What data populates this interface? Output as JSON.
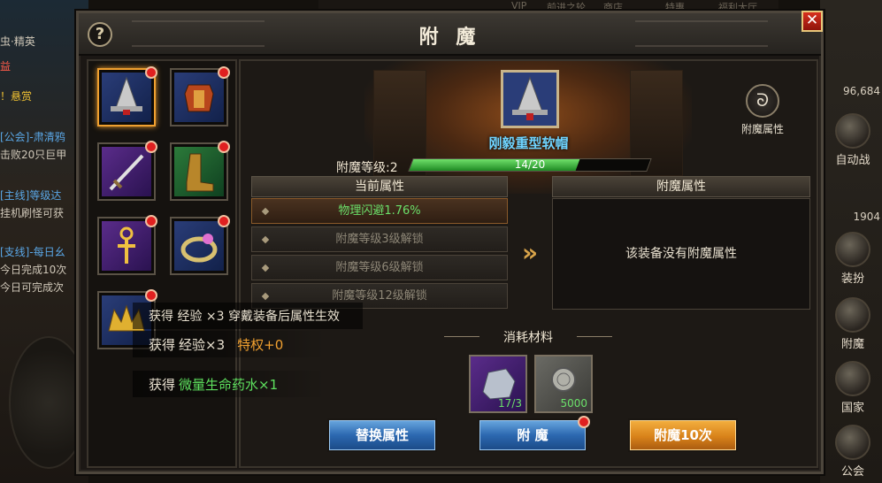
{
  "hud": {
    "top_items": [
      "VIP",
      "前进之轮",
      "商店",
      "特惠",
      "福利大厅"
    ],
    "quest_lines": [
      {
        "text": "虫·精英",
        "style": ""
      },
      {
        "text": "益",
        "style": "red"
      },
      {
        "text": "！悬赏",
        "style": "gold"
      },
      {
        "text": "[公会]-肃清鸦",
        "style": "blue"
      },
      {
        "text": "击败20只巨甲",
        "style": ""
      },
      {
        "text": "[主线]等级达",
        "style": "blue"
      },
      {
        "text": "挂机刷怪可获",
        "style": ""
      },
      {
        "text": "[支线]-每日幺",
        "style": "blue"
      },
      {
        "text": "今日完成10次",
        "style": ""
      },
      {
        "text": "今日可完成次",
        "style": ""
      }
    ],
    "right_number": "96,684",
    "right_number2": "1904",
    "side_buttons": [
      "自动战",
      "装扮",
      "附魔",
      "国家",
      "公会"
    ],
    "rewards": [
      {
        "prefix": "获得",
        "item": "经验×3",
        "extra": "特权+0"
      },
      {
        "prefix": "获得",
        "item": "微量生命药水×1",
        "extra": ""
      }
    ],
    "reward_hidden_line": "获得 经验 ×3 穿戴装备后属性生效"
  },
  "panel": {
    "title": "附 魔",
    "help_label": "?",
    "close_label": "✕"
  },
  "equipment": [
    {
      "name": "hat",
      "bg": "blue",
      "selected": true
    },
    {
      "name": "armor",
      "bg": "blue",
      "selected": false
    },
    {
      "name": "sword",
      "bg": "purple",
      "selected": false
    },
    {
      "name": "boots",
      "bg": "green",
      "selected": false
    },
    {
      "name": "ankh-necklace",
      "bg": "purple",
      "selected": false
    },
    {
      "name": "ring",
      "bg": "blue",
      "selected": false
    },
    {
      "name": "crown",
      "bg": "blue",
      "selected": false
    }
  ],
  "item": {
    "name": "刚毅重型软帽",
    "enchant_level_label": "附魔等级:2",
    "progress": {
      "current": 14,
      "max": 20,
      "text": "14/20"
    }
  },
  "enchant_attr_button": "附魔属性",
  "current_attrs": {
    "header": "当前属性",
    "rows": [
      {
        "text": "物理闪避1.76%",
        "active": true
      },
      {
        "text": "附魔等级3级解锁",
        "active": false
      },
      {
        "text": "附魔等级6级解锁",
        "active": false
      },
      {
        "text": "附魔等级12级解锁",
        "active": false
      }
    ]
  },
  "enchant_attrs": {
    "header": "附魔属性",
    "empty_text": "该装备没有附魔属性"
  },
  "materials": {
    "title": "消耗材料",
    "items": [
      {
        "name": "enchant-stone",
        "count": "17/3",
        "bg": "purple"
      },
      {
        "name": "silver-coin",
        "count": "5000",
        "bg": "gray"
      }
    ]
  },
  "buttons": {
    "replace": "替换属性",
    "enchant": "附 魔",
    "enchant10": "附魔10次"
  },
  "colors": {
    "accent_green": "#6be06a",
    "item_name_blue": "#6fd4ff",
    "button_blue": "#2c68b0",
    "button_orange": "#d8821a"
  }
}
